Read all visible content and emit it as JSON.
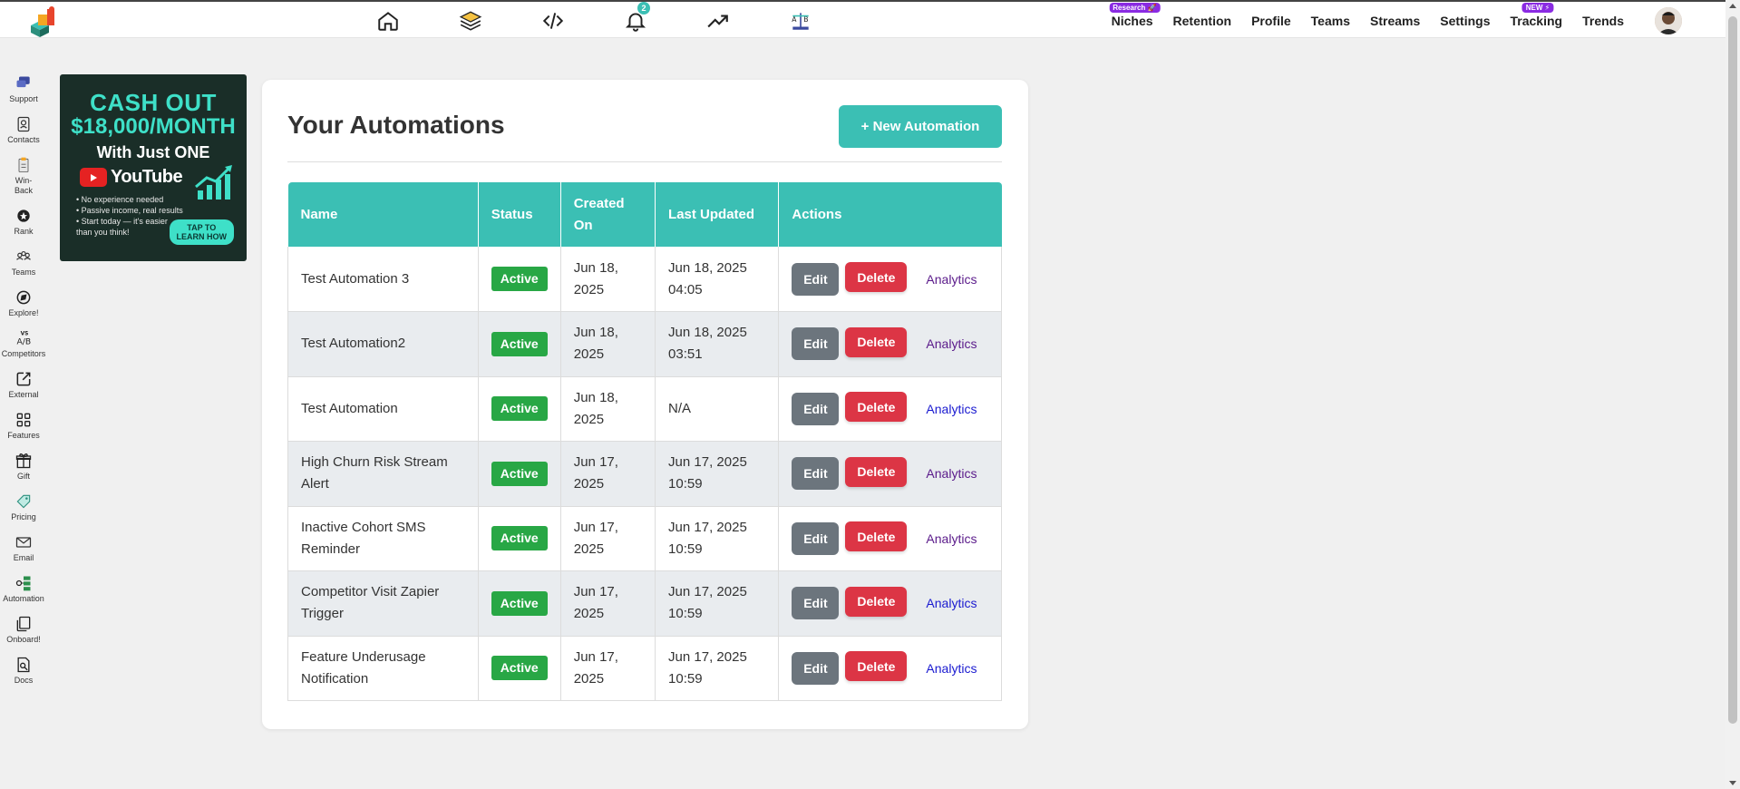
{
  "topbar": {
    "icons": [
      "home-icon",
      "layers-icon",
      "code-icon",
      "bell-icon",
      "trending-up-icon",
      "ab-test-icon"
    ],
    "notification_count": "2",
    "nav": [
      {
        "label": "Niches",
        "tag": "Research 🚀"
      },
      {
        "label": "Retention",
        "tag": ""
      },
      {
        "label": "Profile",
        "tag": ""
      },
      {
        "label": "Teams",
        "tag": ""
      },
      {
        "label": "Streams",
        "tag": ""
      },
      {
        "label": "Settings",
        "tag": ""
      },
      {
        "label": "Tracking",
        "tag": "NEW ⚡"
      },
      {
        "label": "Trends",
        "tag": ""
      }
    ]
  },
  "sidebar": {
    "items": [
      {
        "label": "Support",
        "icon": "support-chat-icon"
      },
      {
        "label": "Contacts",
        "icon": "contacts-book-icon"
      },
      {
        "label": "Win-Back",
        "icon": "clipboard-icon"
      },
      {
        "label": "Rank",
        "icon": "rank-badge-icon"
      },
      {
        "label": "Teams",
        "icon": "team-icon"
      },
      {
        "label": "Explore!",
        "icon": "compass-icon"
      },
      {
        "label": "Competitors",
        "icon": "versus-icon"
      },
      {
        "label": "External",
        "icon": "external-link-icon"
      },
      {
        "label": "Features",
        "icon": "grid-icon"
      },
      {
        "label": "Gift",
        "icon": "gift-icon"
      },
      {
        "label": "Pricing",
        "icon": "price-tag-icon"
      },
      {
        "label": "Email",
        "icon": "envelope-icon"
      },
      {
        "label": "Automation",
        "icon": "automation-icon"
      },
      {
        "label": "Onboard!",
        "icon": "copy-pages-icon"
      },
      {
        "label": "Docs",
        "icon": "doc-search-icon"
      }
    ]
  },
  "ad": {
    "line1": "CASH OUT",
    "line2": "$18,000/MONTH",
    "line3": "With Just ONE",
    "brand": "YouTube",
    "bullets": [
      "• No experience needed",
      "• Passive income, real results",
      "• Start today — it's easier",
      "  than you think!"
    ],
    "cta_line1": "TAP TO",
    "cta_line2": "LEARN HOW"
  },
  "main": {
    "title": "Your Automations",
    "new_button": "+ New Automation",
    "columns": [
      "Name",
      "Status",
      "Created On",
      "Last Updated",
      "Actions"
    ],
    "rows": [
      {
        "name": "Test Automation 3",
        "status": "Active",
        "created_l1": "Jun 18,",
        "created_l2": "2025",
        "updated_l1": "Jun 18, 2025",
        "updated_l2": "04:05",
        "analytics_visited": true
      },
      {
        "name": "Test Automation2",
        "status": "Active",
        "created_l1": "Jun 18,",
        "created_l2": "2025",
        "updated_l1": "Jun 18, 2025",
        "updated_l2": "03:51",
        "analytics_visited": true
      },
      {
        "name": "Test Automation",
        "status": "Active",
        "created_l1": "Jun 18,",
        "created_l2": "2025",
        "updated_l1": "N/A",
        "updated_l2": "",
        "analytics_visited": false
      },
      {
        "name": "High Churn Risk Stream Alert",
        "status": "Active",
        "created_l1": "Jun 17,",
        "created_l2": "2025",
        "updated_l1": "Jun 17, 2025",
        "updated_l2": "10:59",
        "analytics_visited": true
      },
      {
        "name": "Inactive Cohort SMS Reminder",
        "status": "Active",
        "created_l1": "Jun 17,",
        "created_l2": "2025",
        "updated_l1": "Jun 17, 2025",
        "updated_l2": "10:59",
        "analytics_visited": true
      },
      {
        "name": "Competitor Visit Zapier Trigger",
        "status": "Active",
        "created_l1": "Jun 17,",
        "created_l2": "2025",
        "updated_l1": "Jun 17, 2025",
        "updated_l2": "10:59",
        "analytics_visited": false
      },
      {
        "name": "Feature Underusage Notification",
        "status": "Active",
        "created_l1": "Jun 17,",
        "created_l2": "2025",
        "updated_l1": "Jun 17, 2025",
        "updated_l2": "10:59",
        "analytics_visited": false
      }
    ],
    "action_labels": {
      "edit": "Edit",
      "delete": "Delete",
      "analytics": "Analytics"
    }
  },
  "colors": {
    "accent": "#3bbfb4",
    "active": "#28a745",
    "delete": "#dc3545",
    "edit": "#6c757d"
  }
}
